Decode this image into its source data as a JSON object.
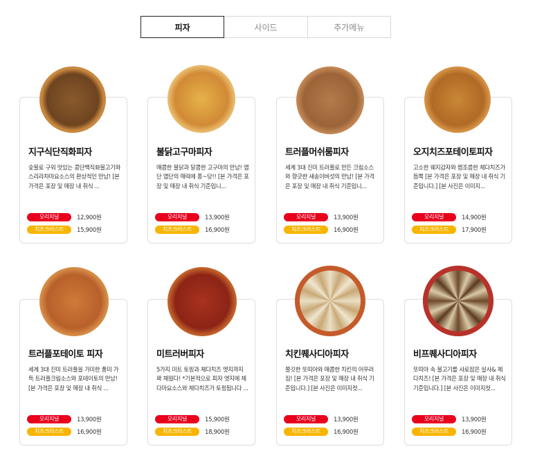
{
  "tabs": [
    {
      "label": "피자",
      "active": true
    },
    {
      "label": "사이드",
      "active": false
    },
    {
      "label": "추가메뉴",
      "active": false
    }
  ],
  "products": [
    {
      "name": "지구식단직화피자",
      "desc": "숯불로 구워 맛있는 콩단백직화불고기와 스리라차마요소스의 환상적인 만남! [본 가격은 포장 및 매장 내 취식 ...",
      "original_label": "오리지널",
      "original_price": "12,900원",
      "cheese_label": "치즈크러스트",
      "cheese_price": "15,900원"
    },
    {
      "name": "불닭고구마피자",
      "desc": "매콤한 불닭과 달콤한 고구마의 만남! 맵단 맵단의 매력에 퐁~당!! [본 가격은 포장 및 매장 내 취식 기준입니...",
      "original_label": "오리지널",
      "original_price": "13,900원",
      "cheese_label": "치즈크러스트",
      "cheese_price": "16,900원"
    },
    {
      "name": "트러플머쉬룸피자",
      "desc": "세계 3대 진미 트러플로 만든 크림소스와 향긋한 새송이버섯의 만남! [본 가격은 포장 및 매장 내 취식 기준입니...",
      "original_label": "오리지널",
      "original_price": "13,900원",
      "cheese_label": "치즈크러스트",
      "cheese_price": "16,900원"
    },
    {
      "name": "오지치즈포테이토피자",
      "desc": "고소한 웨지감자와 짭조름한 체다치즈가 듬뿍 [본 가격은 포장 및 매장 내 취식 기준입니다.] [본 사진은 이미지...",
      "original_label": "오리지널",
      "original_price": "14,900원",
      "cheese_label": "치즈크러스트",
      "cheese_price": "17,900원"
    },
    {
      "name": "트러플포테이토 피자",
      "desc": "세계 3대 진미 트러플을 가미한 풍미 가득 트러플크림소스와 포테이토의 만남! [본 가격은 포장 및 매장 내 취식 ...",
      "original_label": "오리지널",
      "original_price": "13,900원",
      "cheese_label": "치즈크러스트",
      "cheese_price": "16,900원"
    },
    {
      "name": "미트러버피자",
      "desc": "5가지 미트 토핑과 체다치즈 엣지까지 꽉 채웠다! *기본적으로 피자 엣지에 체다마요소스와 체다치즈가 토핑됩니다 ...",
      "original_label": "오리지널",
      "original_price": "15,900원",
      "cheese_label": "치즈크러스트",
      "cheese_price": "18,900원"
    },
    {
      "name": "치킨퀘사디아피자",
      "desc": "쫄깃한 또띠아와 매콤한 치킨의 어우러짐! [본 가격은 포장 및 매장 내 취식 기준입니다.] [본 사진은 이미지컷...",
      "original_label": "오리지널",
      "original_price": "13,900원",
      "cheese_label": "치즈크러스트",
      "cheese_price": "16,900원"
    },
    {
      "name": "비프퀘사디아피자",
      "desc": "또띠아 속 불고기를 샤로잡은 살사& 체다치즈! [본 가격은 포장 및 매장 내 취식 기준입니다.] [본 사진은 이미지컷...",
      "original_label": "오리지널",
      "original_price": "13,900원",
      "cheese_label": "치즈크러스트",
      "cheese_price": "16,900원"
    }
  ],
  "colors": {
    "original_badge": "#e8001c",
    "cheese_badge": "#f7b500",
    "card_border": "#dcdcdc"
  }
}
